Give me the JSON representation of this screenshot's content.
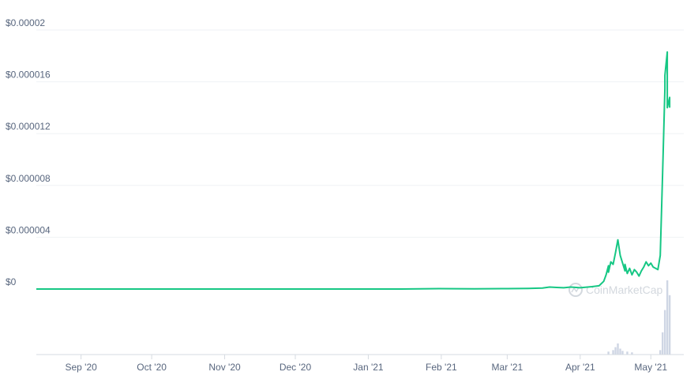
{
  "chart_data": {
    "type": "line",
    "yaxis": {
      "ticks": [
        0,
        4e-06,
        8e-06,
        1.2e-05,
        1.6e-05,
        2e-05
      ],
      "tick_labels": [
        "$0",
        "$0.000004",
        "$0.000008",
        "$0.000012",
        "$0.000016",
        "$0.00002"
      ],
      "ylim": [
        0,
        2e-05
      ]
    },
    "xaxis": {
      "range": [
        "2020-08-13",
        "2021-05-15"
      ],
      "ticks": [
        "2020-09-01",
        "2020-10-01",
        "2020-11-01",
        "2020-12-01",
        "2021-01-01",
        "2021-02-01",
        "2021-03-01",
        "2021-04-01",
        "2021-05-01"
      ],
      "tick_labels": [
        "Sep '20",
        "Oct '20",
        "Nov '20",
        "Dec '20",
        "Jan '21",
        "Feb '21",
        "Mar '21",
        "Apr '21",
        "May '21"
      ]
    },
    "grid": true,
    "colors": {
      "price_line": "#16c784",
      "volume_bars": "#cfd6e4",
      "grid": "#eff2f5"
    },
    "watermark": "CoinMarketCap",
    "series": [
      {
        "points": [
          [
            "2020-08-13",
            0.0
          ],
          [
            "2020-09-15",
            0.0
          ],
          [
            "2020-10-15",
            0.0
          ],
          [
            "2020-11-15",
            0.0
          ],
          [
            "2020-12-15",
            0.0
          ],
          [
            "2021-01-15",
            0.0
          ],
          [
            "2021-01-31",
            3e-08
          ],
          [
            "2021-02-15",
            2e-08
          ],
          [
            "2021-03-01",
            3e-08
          ],
          [
            "2021-03-10",
            5e-08
          ],
          [
            "2021-03-16",
            8e-08
          ],
          [
            "2021-03-19",
            1.5e-07
          ],
          [
            "2021-03-22",
            1.2e-07
          ],
          [
            "2021-03-25",
            1e-07
          ],
          [
            "2021-03-28",
            1.5e-07
          ],
          [
            "2021-04-01",
            1e-07
          ],
          [
            "2021-04-06",
            1.8e-07
          ],
          [
            "2021-04-09",
            2.5e-07
          ],
          [
            "2021-04-11",
            6e-07
          ],
          [
            "2021-04-12",
            1.1e-06
          ],
          [
            "2021-04-13",
            1.8e-06
          ],
          [
            "2021-04-13",
            1.3e-06
          ],
          [
            "2021-04-14",
            2.1e-06
          ],
          [
            "2021-04-15",
            1.9e-06
          ],
          [
            "2021-04-16",
            2.8e-06
          ],
          [
            "2021-04-17",
            3.8e-06
          ],
          [
            "2021-04-18",
            2.6e-06
          ],
          [
            "2021-04-19",
            2e-06
          ],
          [
            "2021-04-20",
            1.4e-06
          ],
          [
            "2021-04-20",
            1.9e-06
          ],
          [
            "2021-04-21",
            1.2e-06
          ],
          [
            "2021-04-22",
            1.6e-06
          ],
          [
            "2021-04-23",
            1.1e-06
          ],
          [
            "2021-04-24",
            1.5e-06
          ],
          [
            "2021-04-25",
            1.3e-06
          ],
          [
            "2021-04-26",
            1e-06
          ],
          [
            "2021-04-27",
            1.4e-06
          ],
          [
            "2021-04-28",
            1.7e-06
          ],
          [
            "2021-04-29",
            2.1e-06
          ],
          [
            "2021-04-30",
            1.8e-06
          ],
          [
            "2021-05-01",
            2e-06
          ],
          [
            "2021-05-02",
            1.7e-06
          ],
          [
            "2021-05-03",
            1.6e-06
          ],
          [
            "2021-05-04",
            1.5e-06
          ],
          [
            "2021-05-05",
            2.6e-06
          ],
          [
            "2021-05-06",
            9e-06
          ],
          [
            "2021-05-07",
            1.55e-05
          ],
          [
            "2021-05-07",
            1.65e-05
          ],
          [
            "2021-05-08",
            1.83e-05
          ],
          [
            "2021-05-08",
            1.65e-05
          ],
          [
            "2021-05-08",
            1.45e-05
          ],
          [
            "2021-05-08",
            1.4e-05
          ],
          [
            "2021-05-09",
            1.48e-05
          ],
          [
            "2021-05-09",
            1.4e-05
          ]
        ]
      }
    ],
    "volume": [
      [
        "2021-04-13",
        0.04
      ],
      [
        "2021-04-15",
        0.06
      ],
      [
        "2021-04-16",
        0.1
      ],
      [
        "2021-04-17",
        0.15
      ],
      [
        "2021-04-18",
        0.08
      ],
      [
        "2021-04-19",
        0.05
      ],
      [
        "2021-04-21",
        0.04
      ],
      [
        "2021-04-23",
        0.03
      ],
      [
        "2021-05-05",
        0.06
      ],
      [
        "2021-05-06",
        0.3
      ],
      [
        "2021-05-07",
        0.6
      ],
      [
        "2021-05-08",
        1.0
      ],
      [
        "2021-05-09",
        0.8
      ]
    ]
  }
}
